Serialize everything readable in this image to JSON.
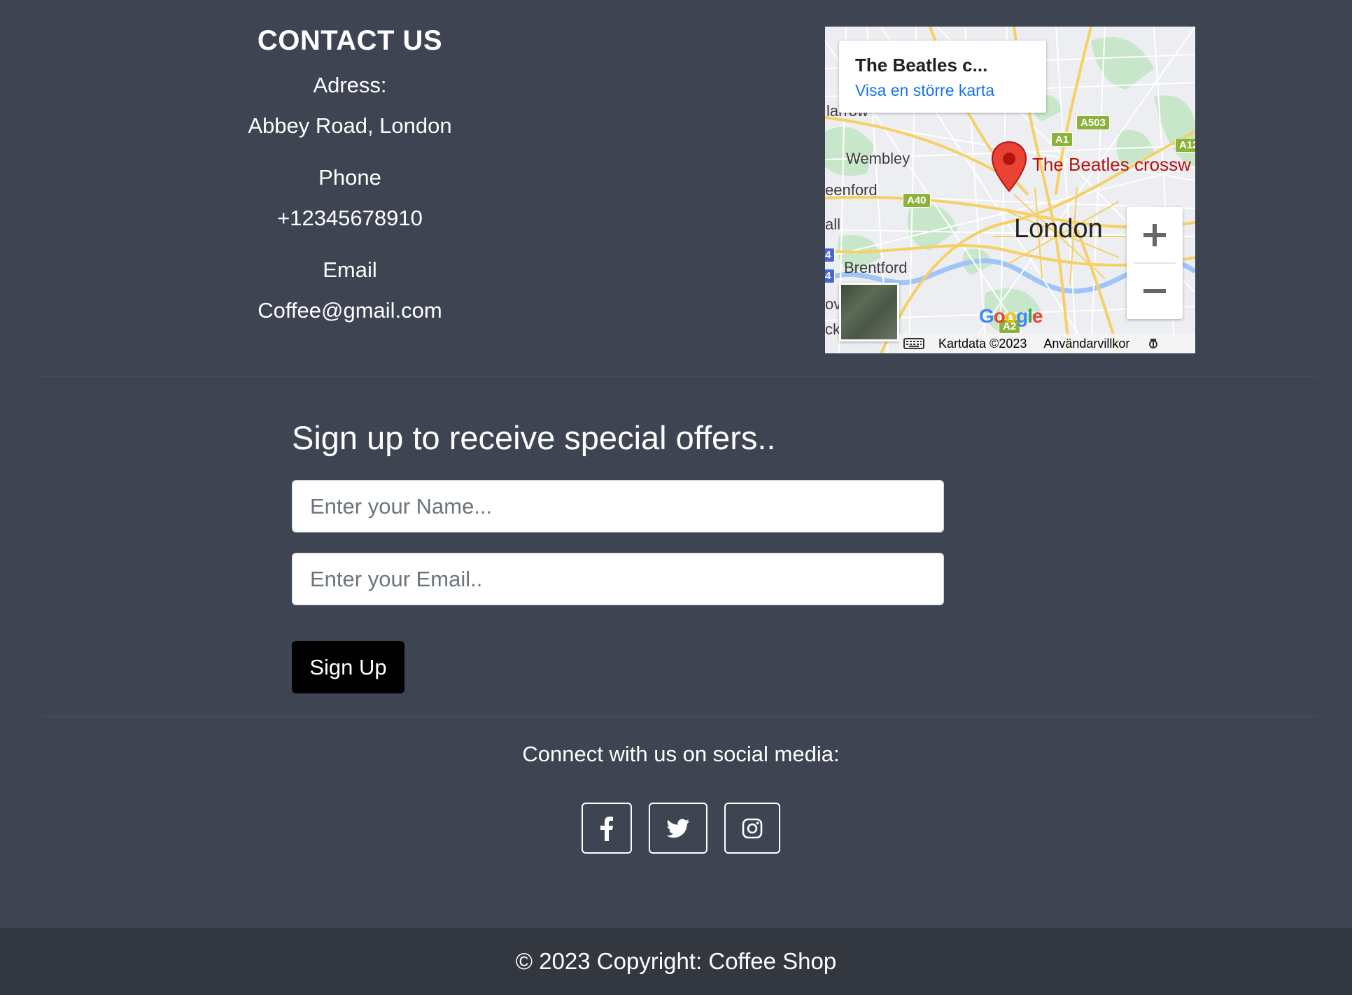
{
  "contact": {
    "title": "CONTACT US",
    "address_label": "Adress:",
    "address_value": "Abbey Road, London",
    "phone_label": "Phone",
    "phone_value": "+12345678910",
    "email_label": "Email",
    "email_value": "Coffee@gmail.com"
  },
  "map": {
    "info_title": "The Beatles c...",
    "info_link": "Visa en större karta",
    "place_label": "The Beatles crossw",
    "city_label": "London",
    "labels": {
      "wembley": "Wembley",
      "brentford": "Brentford",
      "greenford": "eenford",
      "harrow": "larrow",
      "hall": "all",
      "ov": "ov",
      "ck": "ck"
    },
    "roads": {
      "a1": "A1",
      "a503": "A503",
      "a40": "A40",
      "a12": "A12",
      "a2": "A2",
      "blue1": "4",
      "blue2": "4"
    },
    "google_logo": "Google",
    "data_text": "Kartdata ©2023",
    "terms_text": "Användarvillkor",
    "zoom_in": "+",
    "zoom_out": "−",
    "icons": [
      "map-pin-icon",
      "keyboard-icon",
      "bug-report-icon"
    ]
  },
  "signup": {
    "title": "Sign up to receive special offers..",
    "name_placeholder": "Enter your Name...",
    "email_placeholder": "Enter your Email..",
    "button_label": "Sign Up"
  },
  "social": {
    "title": "Connect with us on social media:",
    "icons": [
      "facebook-icon",
      "twitter-icon",
      "instagram-icon"
    ]
  },
  "footer": {
    "copyright": "© 2023 Copyright: Coffee Shop"
  },
  "colors": {
    "background": "#3e4451",
    "footer_background": "#333740",
    "button": "#000000",
    "link": "#1a73e8",
    "pin": "#ea4335"
  }
}
